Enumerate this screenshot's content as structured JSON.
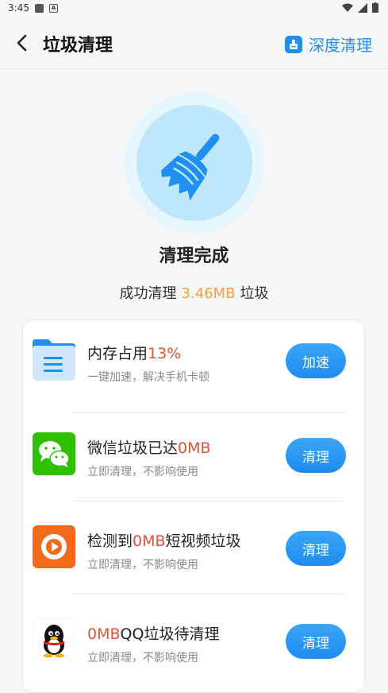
{
  "status_bar": {
    "time": "3:45",
    "icon2_letter": "A"
  },
  "header": {
    "title": "垃圾清理",
    "deep_clean_label": "深度清理"
  },
  "result": {
    "title": "清理完成",
    "prefix": "成功清理",
    "amount": "3.46MB",
    "suffix": "垃圾"
  },
  "items": [
    {
      "icon": "folder-icon",
      "pre": "内存占用",
      "hl": "13%",
      "post": "",
      "sub": "一键加速，解决手机卡顿",
      "button": "加速"
    },
    {
      "icon": "wechat-icon",
      "pre": "微信垃圾已达",
      "hl": "0MB",
      "post": "",
      "sub": "立即清理，不影响使用",
      "button": "清理"
    },
    {
      "icon": "short-video-icon",
      "pre": "检测到",
      "hl": "0MB",
      "post": "短视频垃圾",
      "sub": "立即清理，不影响使用",
      "button": "清理"
    },
    {
      "icon": "qq-icon",
      "pre": "",
      "hl": "0MB",
      "post": "QQ垃圾待清理",
      "sub": "立即清理，不影响使用",
      "button": "清理"
    }
  ],
  "colors": {
    "accent": "#1f8ff0",
    "highlight": "#e0533a",
    "amount": "#f4a13f"
  }
}
